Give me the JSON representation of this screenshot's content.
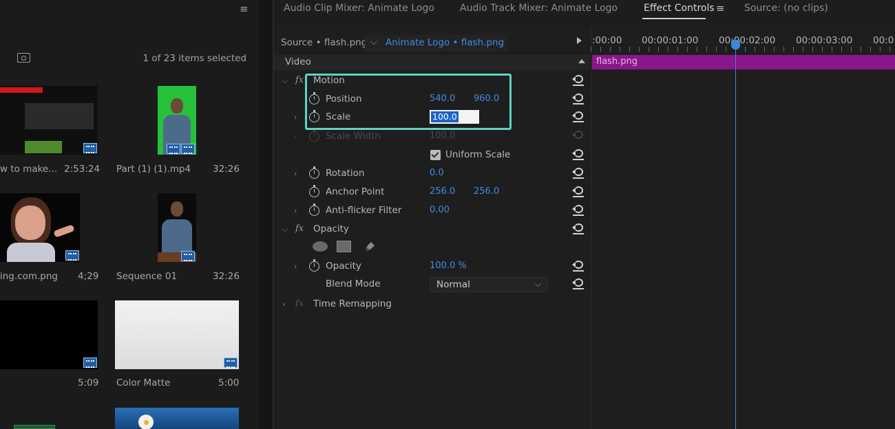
{
  "project": {
    "items_count": "1 of 23 items selected",
    "items": [
      {
        "name": "w to make...",
        "duration": "2:53:24"
      },
      {
        "name": "Part (1) (1).mp4",
        "duration": "32:26"
      },
      {
        "name": "ing.com.png",
        "duration": "4;29"
      },
      {
        "name": "Sequence 01",
        "duration": "32:26"
      },
      {
        "name": "",
        "duration": "5:09"
      },
      {
        "name": "Color Matte",
        "duration": "5:00"
      }
    ]
  },
  "tabs": [
    {
      "label": "Audio Clip Mixer: Animate Logo"
    },
    {
      "label": "Audio Track Mixer: Animate Logo"
    },
    {
      "label": "Effect Controls"
    },
    {
      "label": "Source: (no clips)"
    }
  ],
  "effect_controls": {
    "source_label": "Source • flash.png",
    "sequence_label": "Animate Logo • flash.png",
    "video_label": "Video",
    "motion": "Motion",
    "position": {
      "label": "Position",
      "x": "540.0",
      "y": "960.0"
    },
    "scale": {
      "label": "Scale",
      "value": "100.0"
    },
    "scale_width": {
      "label": "Scale Width",
      "value": "100.0"
    },
    "uniform_scale": {
      "label": "Uniform Scale",
      "checked": true
    },
    "rotation": {
      "label": "Rotation",
      "value": "0.0"
    },
    "anchor_point": {
      "label": "Anchor Point",
      "x": "256.0",
      "y": "256.0"
    },
    "anti_flicker": {
      "label": "Anti-flicker Filter",
      "value": "0.00"
    },
    "opacity_group": "Opacity",
    "opacity": {
      "label": "Opacity",
      "value": "100.0 %"
    },
    "blend_mode": {
      "label": "Blend Mode",
      "value": "Normal"
    },
    "time_remapping": "Time Remapping"
  },
  "timeline": {
    "timecodes": [
      ":00:00",
      "00:00:01:00",
      "00:00:02:00",
      "00:00:03:00",
      "00:0"
    ],
    "clip_name": "flash.png"
  },
  "colors": {
    "accent_blue": "#3f8de4",
    "clip_purple": "#8a168c",
    "highlight": "#5cd6c0"
  }
}
